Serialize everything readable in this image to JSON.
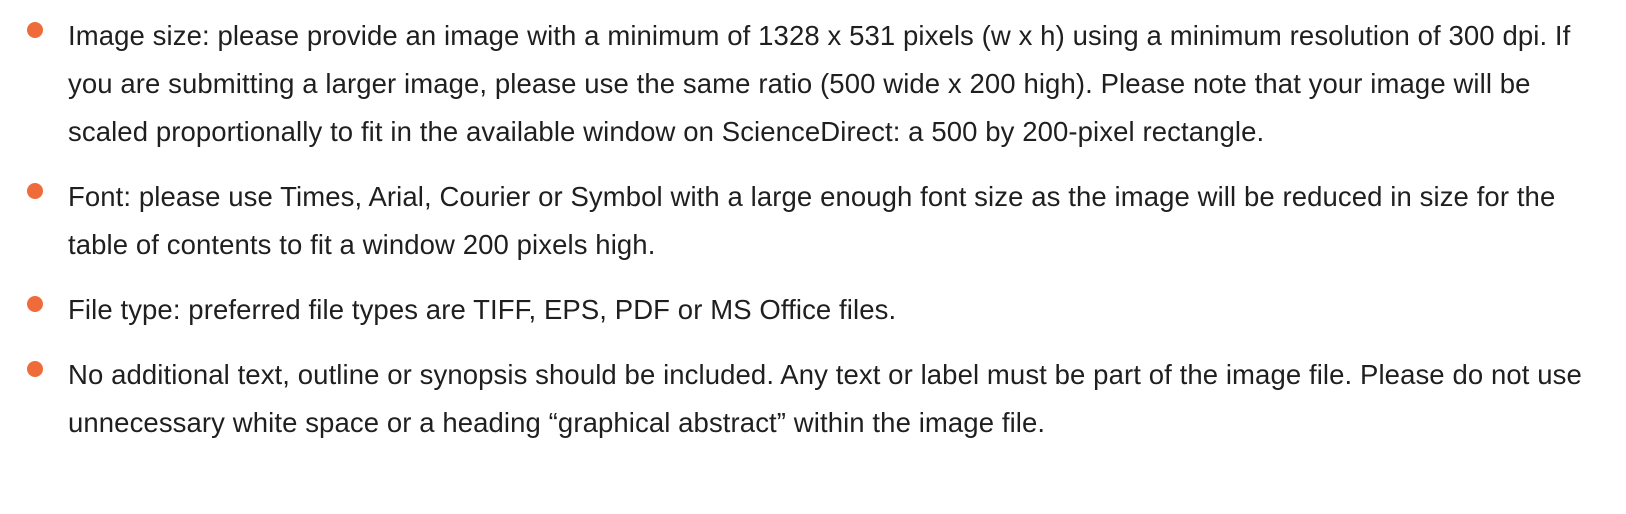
{
  "colors": {
    "bullet": "#ef6c3a",
    "text": "#1f1f1f",
    "background": "#ffffff"
  },
  "guidelines": [
    {
      "icon": "bullet-dot-icon",
      "text": "Image size: please provide an image with a minimum of 1328 x 531 pixels (w x h) using a minimum resolution of 300 dpi. If you are submitting a larger image, please use the same ratio (500 wide x 200 high). Please note that your image will be scaled proportionally to fit in the available window on ScienceDirect: a 500 by 200-pixel rectangle."
    },
    {
      "icon": "bullet-dot-icon",
      "text": "Font: please use Times, Arial, Courier or Symbol with a large enough font size as the image will be reduced in size for the table of contents to fit a window 200 pixels high."
    },
    {
      "icon": "bullet-dot-icon",
      "text": "File type: preferred file types are TIFF, EPS, PDF or MS Office files."
    },
    {
      "icon": "bullet-dot-icon",
      "text": "No additional text, outline or synopsis should be included. Any text or label must be part of the image file. Please do not use unnecessary white space or a heading “graphical abstract” within the image file."
    }
  ]
}
